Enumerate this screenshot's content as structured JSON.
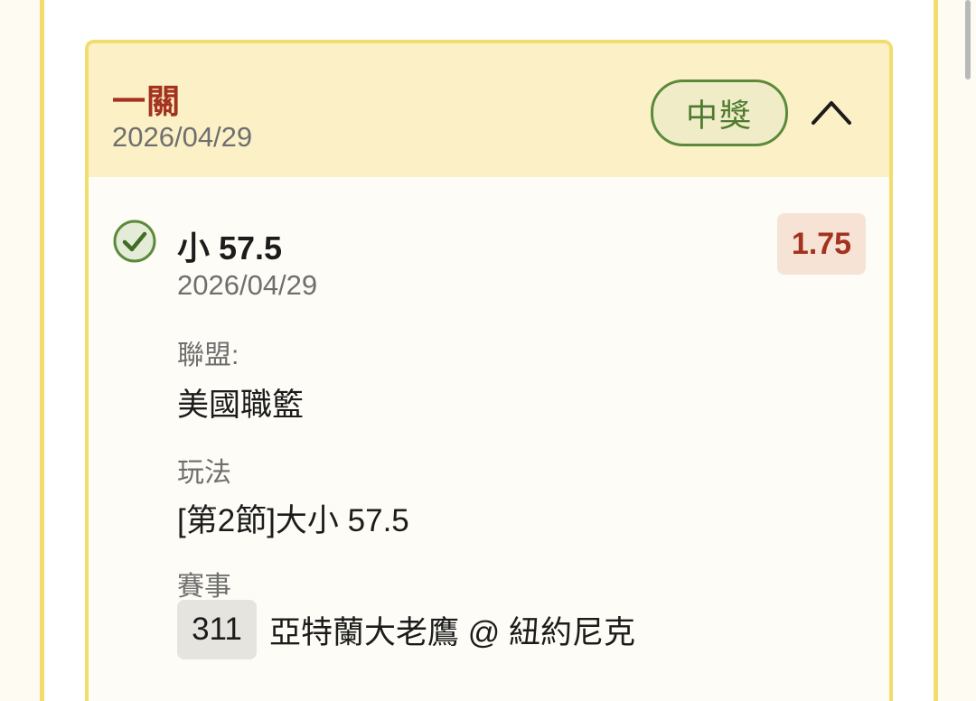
{
  "card": {
    "bet_type": "一關",
    "date": "2026/04/29",
    "status": "中獎"
  },
  "selection": {
    "title": "小 57.5",
    "date": "2026/04/29",
    "odds": "1.75"
  },
  "details": {
    "league_label": "聯盟:",
    "league_value": "美國職籃",
    "market_label": "玩法",
    "market_value": "[第2節]大小 57.5",
    "event_label": "賽事",
    "event_number": "311",
    "event_name": "亞特蘭大老鷹 @ 紐約尼克"
  },
  "icons": {
    "collapse": "chevron-up-icon",
    "result": "check-circle-icon"
  },
  "colors": {
    "frame": "#f2dd6c",
    "header_bg": "#fcf1c6",
    "accent_red": "#a3321f",
    "win_green": "#5b8a3a",
    "odds_bg": "#f7e3d6"
  }
}
